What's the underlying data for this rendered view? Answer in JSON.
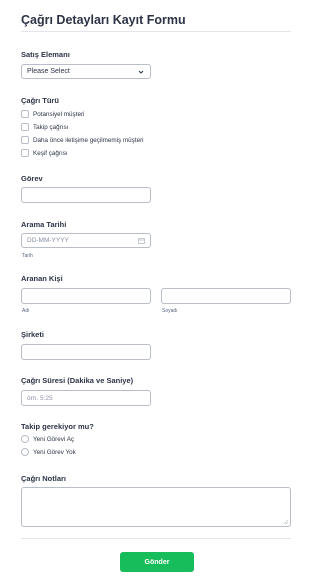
{
  "form": {
    "title": "Çağrı Detayları Kayıt Formu",
    "sales_rep": {
      "label": "Satış Elemanı",
      "selected": "Please Select"
    },
    "call_type": {
      "label": "Çağrı Türü",
      "options": [
        "Potansiyel müşteri",
        "Takip çağrısı",
        "Daha önce iletişime geçilmemiş müşteri",
        "Keşif çağrısı"
      ]
    },
    "task": {
      "label": "Görev",
      "value": ""
    },
    "call_date": {
      "label": "Arama Tarihi",
      "placeholder": "DD-MM-YYYY",
      "sublabel": "Tarih"
    },
    "callee": {
      "label": "Aranan Kişi",
      "first_sublabel": "Adı",
      "last_sublabel": "Soyadı"
    },
    "company": {
      "label": "Şirketi",
      "value": ""
    },
    "duration": {
      "label": "Çağrı Süresi (Dakika ve Saniye)",
      "placeholder": "örn. 5:25"
    },
    "followup": {
      "label": "Takip gerekiyor mu?",
      "options": [
        "Yeni Görevi Aç",
        "Yeni Görev Yok"
      ]
    },
    "notes": {
      "label": "Çağrı Notları",
      "value": ""
    },
    "submit_label": "Gönder"
  },
  "colors": {
    "accent": "#18bd5b",
    "text": "#2c3345",
    "border": "#b8bdc9"
  }
}
